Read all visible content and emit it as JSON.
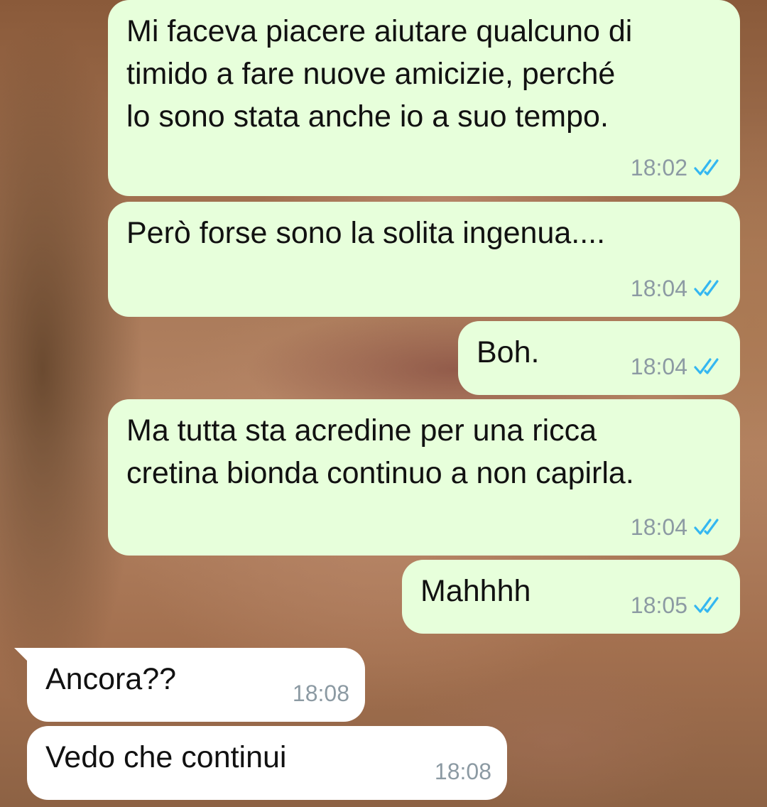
{
  "messages": [
    {
      "direction": "outgoing",
      "text": "Mi faceva piacere aiutare qualcuno di\ntimido a fare nuove amicizie, perché\nlo sono stata anche io a suo tempo.",
      "time": "18:02",
      "status": "read"
    },
    {
      "direction": "outgoing",
      "text": "Però forse sono la solita ingenua....",
      "time": "18:04",
      "status": "read"
    },
    {
      "direction": "outgoing",
      "text": "Boh.",
      "time": "18:04",
      "status": "read"
    },
    {
      "direction": "outgoing",
      "text": "Ma tutta sta acredine per una ricca\ncretina bionda continuo a non capirla.",
      "time": "18:04",
      "status": "read"
    },
    {
      "direction": "outgoing",
      "text": "Mahhhh",
      "time": "18:05",
      "status": "read"
    },
    {
      "direction": "incoming",
      "text": "Ancora??",
      "time": "18:08"
    },
    {
      "direction": "incoming",
      "text": "Vedo che continui",
      "time": "18:08"
    }
  ],
  "colors": {
    "outgoing_bubble": "#e7ffdb",
    "incoming_bubble": "#ffffff",
    "timestamp": "#8c9aa3",
    "read_ticks": "#34b7f1"
  },
  "icons": {
    "read_receipt": "double-check-icon"
  }
}
